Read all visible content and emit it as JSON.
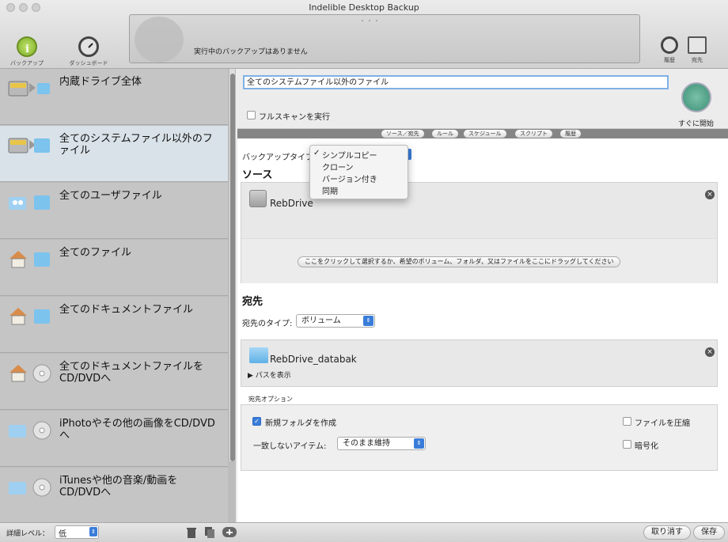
{
  "window": {
    "title": "Indelible Desktop Backup"
  },
  "toolbar": {
    "backup_label": "バックアップ",
    "dashboard_label": "ダッシュボード",
    "history_label": "履歴",
    "destination_label": "宛先",
    "status_text": "実行中のバックアップはありません",
    "status_dots": "・・・"
  },
  "sidebar": {
    "items": [
      {
        "label": "内蔵ドライブ全体",
        "icon": "internal-drive-icon"
      },
      {
        "label": "全てのシステムファイル以外のファイル",
        "icon": "drive-to-folder-icon",
        "selected": true
      },
      {
        "label": "全てのユーザファイル",
        "icon": "users-to-folder-icon"
      },
      {
        "label": "全てのファイル",
        "icon": "home-to-folder-icon"
      },
      {
        "label": "全てのドキュメントファイル",
        "icon": "home-documents-icon"
      },
      {
        "label": "全てのドキュメントファイルをCD/DVDへ",
        "icon": "home-to-disc-icon"
      },
      {
        "label": "iPhotoやその他の画像をCD/DVDへ",
        "icon": "photos-to-disc-icon"
      },
      {
        "label": "iTunesや他の音楽/動画をCD/DVDへ",
        "icon": "music-to-disc-icon"
      }
    ]
  },
  "main": {
    "set_name": "全てのシステムファイル以外のファイル",
    "full_scan_label": "フルスキャンを実行",
    "start_now_label": "すぐに開始",
    "tabs": [
      {
        "label": "ソース／宛先"
      },
      {
        "label": "ルール"
      },
      {
        "label": "スケジュール"
      },
      {
        "label": "スクリプト"
      },
      {
        "label": "履歴"
      }
    ],
    "backup_type_label": "バックアップタイプ:",
    "source_title": "ソース",
    "source_drive": "RebDrive",
    "drop_hint": "ここをクリックして選択するか、希望のボリューム、フォルダ、又はファイルをここにドラッグしてください",
    "dest_title": "宛先",
    "dest_type_label": "宛先のタイプ:",
    "dest_type_value": "ボリューム",
    "dest_name": "RebDrive_databak",
    "show_path_label": "▶ パスを表示",
    "dest_options_title": "宛先オプション",
    "new_folder_label": "新規フォルダを作成",
    "new_folder_checked": true,
    "mismatch_label": "一致しないアイテム:",
    "mismatch_value": "そのまま維持",
    "compress_label": "ファイルを圧縮",
    "encrypt_label": "暗号化"
  },
  "backup_type_menu": {
    "items": [
      {
        "label": "シンプルコピー",
        "checked": true
      },
      {
        "label": "クローン"
      },
      {
        "label": "バージョン付き"
      },
      {
        "label": "同期"
      }
    ]
  },
  "bottom": {
    "detail_label": "詳細レベル：",
    "detail_value": "低",
    "cancel_label": "取り消す",
    "save_label": "保存"
  }
}
